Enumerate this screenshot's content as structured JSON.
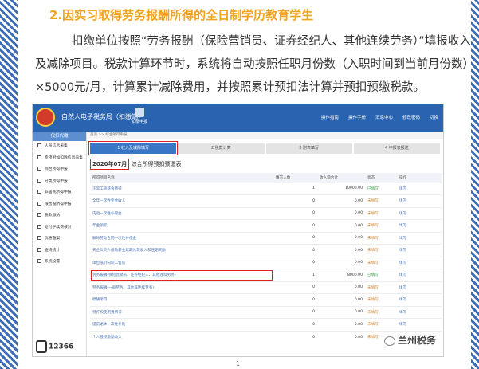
{
  "heading": "2.因实习取得劳务报酬所得的全日制学历教育学生",
  "paragraph": {
    "line1": "扣缴单位按照“劳务报酬（保险营销员、证券经纪人、其他连续劳务）”填报收入",
    "line2": "及减除项目。税款计算环节时，系统将自动按照任职月份数（入职时间到当前月份数）",
    "line3": "×5000元/月，计算累计减除费用，并按照累计预扣法计算并预扣预缴税款。"
  },
  "app": {
    "title": "自然人电子税务局（扣缴端）",
    "home_btn": "扣缴申报",
    "tools": [
      "操作指南",
      "操作手册",
      "消息中心",
      "修改密码",
      "切换"
    ],
    "breadcrumb": "首页 >> 综合所得申报",
    "sidebar_header": "代扣代缴",
    "sidebar_items": [
      "人员信息采集",
      "专项附加扣除信息采集",
      "综合所得申报",
      "分类所得申报",
      "非居民所得申报",
      "限售股所得申报",
      "税款缴纳",
      "退付手续费核对",
      "优惠备案",
      "查询统计",
      "系统设置"
    ],
    "hotline": "12366",
    "steps": [
      "1 收入及减除填写",
      "2 税款计算",
      "3 附表填写",
      "4 申报表报送"
    ],
    "period_value": "2020年07月",
    "period_label": "综合所得预扣预缴表",
    "columns": [
      "所得项目名称",
      "填写人数",
      "收入额合计",
      "状态",
      "操作"
    ],
    "rows": [
      {
        "name": "正常工资薪金所得",
        "count": "1",
        "amount": "10000.00",
        "status": "已填写",
        "op": "填写",
        "st": "st1"
      },
      {
        "name": "全年一次性奖金收入",
        "count": "0",
        "amount": "0.00",
        "status": "未填写",
        "op": "填写",
        "st": "st2"
      },
      {
        "name": "内退一次性补偿金",
        "count": "0",
        "amount": "0.00",
        "status": "未填写",
        "op": "填写",
        "st": "st2"
      },
      {
        "name": "年金领取",
        "count": "0",
        "amount": "0.00",
        "status": "未填写",
        "op": "填写",
        "st": "st2"
      },
      {
        "name": "解除劳动合同一次性补偿金",
        "count": "0",
        "amount": "0.00",
        "status": "未填写",
        "op": "填写",
        "st": "st2"
      },
      {
        "name": "央企负责人绩效薪金延期兑现收入和任期奖励",
        "count": "0",
        "amount": "0.00",
        "status": "未填写",
        "op": "填写",
        "st": "st2"
      },
      {
        "name": "单位低价向职工售房",
        "count": "0",
        "amount": "0.00",
        "status": "未填写",
        "op": "填写",
        "st": "st2"
      },
      {
        "name": "劳务报酬(保险营销员、证券经纪人、其他连续劳务)",
        "count": "1",
        "amount": "8000.00",
        "status": "已填写",
        "op": "填写",
        "st": "st1",
        "hl": true
      },
      {
        "name": "劳务报酬(一般劳务、其他非连续劳务)",
        "count": "0",
        "amount": "0.00",
        "status": "未填写",
        "op": "填写",
        "st": "st2"
      },
      {
        "name": "稿酬所得",
        "count": "0",
        "amount": "0.00",
        "status": "未填写",
        "op": "填写",
        "st": "st2"
      },
      {
        "name": "特许权使用费所得",
        "count": "0",
        "amount": "0.00",
        "status": "未填写",
        "op": "填写",
        "st": "st2"
      },
      {
        "name": "提前退休一次性补贴",
        "count": "0",
        "amount": "0.00",
        "status": "未填写",
        "op": "填写",
        "st": "st2"
      },
      {
        "name": "个人股权激励收入",
        "count": "0",
        "amount": "0.00",
        "status": "未填写",
        "op": "填写",
        "st": "st2"
      }
    ]
  },
  "watermark": "兰州税务",
  "page_number": "1"
}
